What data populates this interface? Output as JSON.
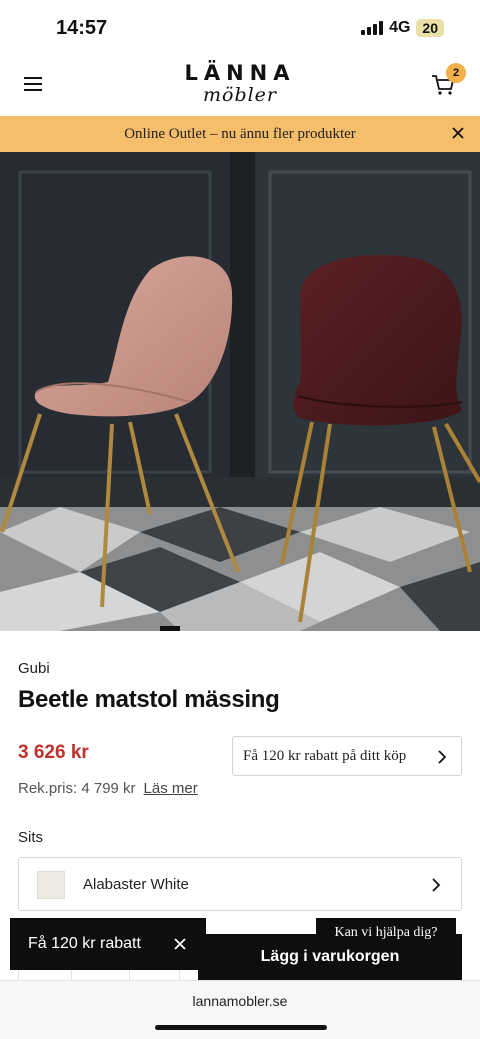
{
  "status_bar": {
    "time": "14:57",
    "network": "4G",
    "battery": "20"
  },
  "header": {
    "logo_main": "LÄNNA",
    "logo_sub": "möbler",
    "cart_count": "2"
  },
  "promo_banner": {
    "text": "Online Outlet – nu ännu fler produkter"
  },
  "product": {
    "brand": "Gubi",
    "title": "Beetle matstol mässing",
    "price": "3 626 kr",
    "rrp_label": "Rek.pris: 4 799 kr",
    "read_more": "Läs mer",
    "discount_offer": "Få 120 kr rabatt på ditt köp",
    "option_label": "Sits",
    "option_value": "Alabaster White"
  },
  "toast": {
    "text": "Få 120 kr rabatt"
  },
  "help": {
    "text": "Kan vi hjälpa dig?"
  },
  "cta": {
    "label": "Lägg i varukorgen"
  },
  "browser": {
    "url": "lannamobler.se"
  },
  "colors": {
    "promo": "#f6bd6a",
    "price": "#c0302c",
    "badge": "#f2b04a",
    "cta": "#0e0e0e"
  }
}
